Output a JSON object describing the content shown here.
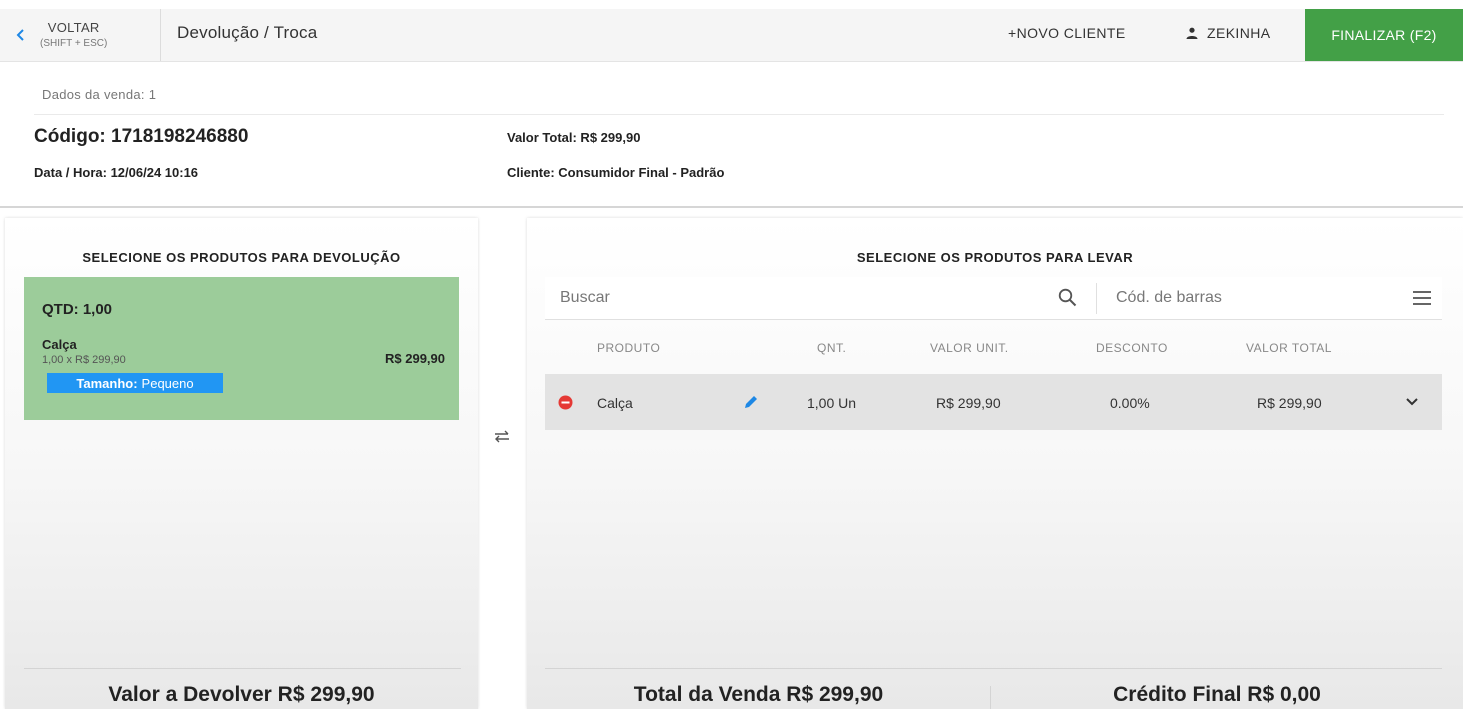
{
  "header": {
    "back_label": "VOLTAR",
    "back_shortcut": "(SHIFT + ESC)",
    "page_title": "Devolução / Troca",
    "new_client_label": "+NOVO CLIENTE",
    "user_name": "ZEKINHA",
    "finish_label": "FINALIZAR (F2)"
  },
  "sale": {
    "caption": "Dados da venda: 1",
    "code": "Código: 1718198246880",
    "datetime": "Data / Hora: 12/06/24 10:16",
    "total": "Valor Total: R$ 299,90",
    "client": "Cliente: Consumidor Final - Padrão"
  },
  "return_panel": {
    "heading": "SELECIONE OS PRODUTOS PARA DEVOLUÇÃO",
    "item": {
      "qty": "QTD: 1,00",
      "name": "Calça",
      "detail": "1,00 x R$ 299,90",
      "price": "R$ 299,90",
      "attr_name": "Tamanho:",
      "attr_value": "Pequeno"
    },
    "footer": "Valor a Devolver R$ 299,90"
  },
  "take_panel": {
    "heading": "SELECIONE OS PRODUTOS PARA LEVAR",
    "search_placeholder": "Buscar",
    "barcode_placeholder": "Cód. de barras",
    "columns": {
      "product": "PRODUTO",
      "qty": "QNT.",
      "unit_value": "VALOR UNIT.",
      "discount": "DESCONTO",
      "total_value": "VALOR TOTAL"
    },
    "rows": [
      {
        "product": "Calça",
        "qty": "1,00 Un",
        "unit_value": "R$ 299,90",
        "discount": "0.00%",
        "total_value": "R$ 299,90"
      }
    ],
    "sale_total": "Total da Venda R$ 299,90",
    "final_credit": "Crédito Final R$ 0,00"
  },
  "colors": {
    "finish_button": "#43a047",
    "return_card": "#9ccc9a",
    "attr_badge": "#2196f3",
    "remove_icon": "#e53935",
    "edit_icon": "#1e88e5"
  }
}
